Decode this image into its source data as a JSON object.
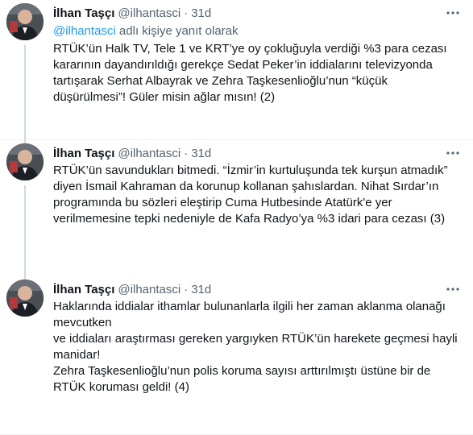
{
  "tweets": [
    {
      "name": "İlhan Taşçı",
      "handle": "@ilhantasci",
      "separator": "·",
      "time": "31d",
      "reply_mention": "@ilhantasci",
      "reply_suffix": " adlı kişiye yanıt olarak",
      "text": "RTÜK’ün Halk TV, Tele 1 ve KRT’ye oy çokluğuyla verdiği %3 para cezası\nkararının dayandırıldığı gerekçe Sedat Peker’in iddialarını televizyonda\ntartışarak Serhat Albayrak ve Zehra Taşkesenlioğlu’nun “küçük\ndüşürülmesi”! Güler misin ağlar mısın! (2)"
    },
    {
      "name": "İlhan Taşçı",
      "handle": "@ilhantasci",
      "separator": "·",
      "time": "31d",
      "text": "RTÜK’ün savundukları bitmedi. “İzmir’in kurtuluşunda tek kurşun atmadık”\ndiyen İsmail Kahraman da korunup kollanan şahıslardan. Nihat Sırdar’ın\nprogramında bu sözleri eleştirip Cuma Hutbesinde Atatürk'e  yer\nverilmemesine tepki nedeniyle de Kafa Radyo’ya %3 idari para cezası (3)"
    },
    {
      "name": "İlhan Taşçı",
      "handle": "@ilhantasci",
      "separator": "·",
      "time": "31d",
      "text": "Haklarında iddialar ithamlar bulunanlarla ilgili her zaman aklanma olanağı\nmevcutken\nve iddiaları araştırması gereken yargıyken RTÜK’ün harekete geçmesi hayli\nmanidar!\nZehra Taşkesenlioğlu’nun polis koruma sayısı arttırılmıştı üstüne bir de\nRTÜK koruması geldi! (4)"
    }
  ],
  "icons": {
    "more": "more-horizontal-icon",
    "avatar": "profile-avatar"
  },
  "colors": {
    "link": "#1d9bf0",
    "secondary": "#536471",
    "thread_line": "#cfd9de",
    "divider": "#eff3f4"
  }
}
